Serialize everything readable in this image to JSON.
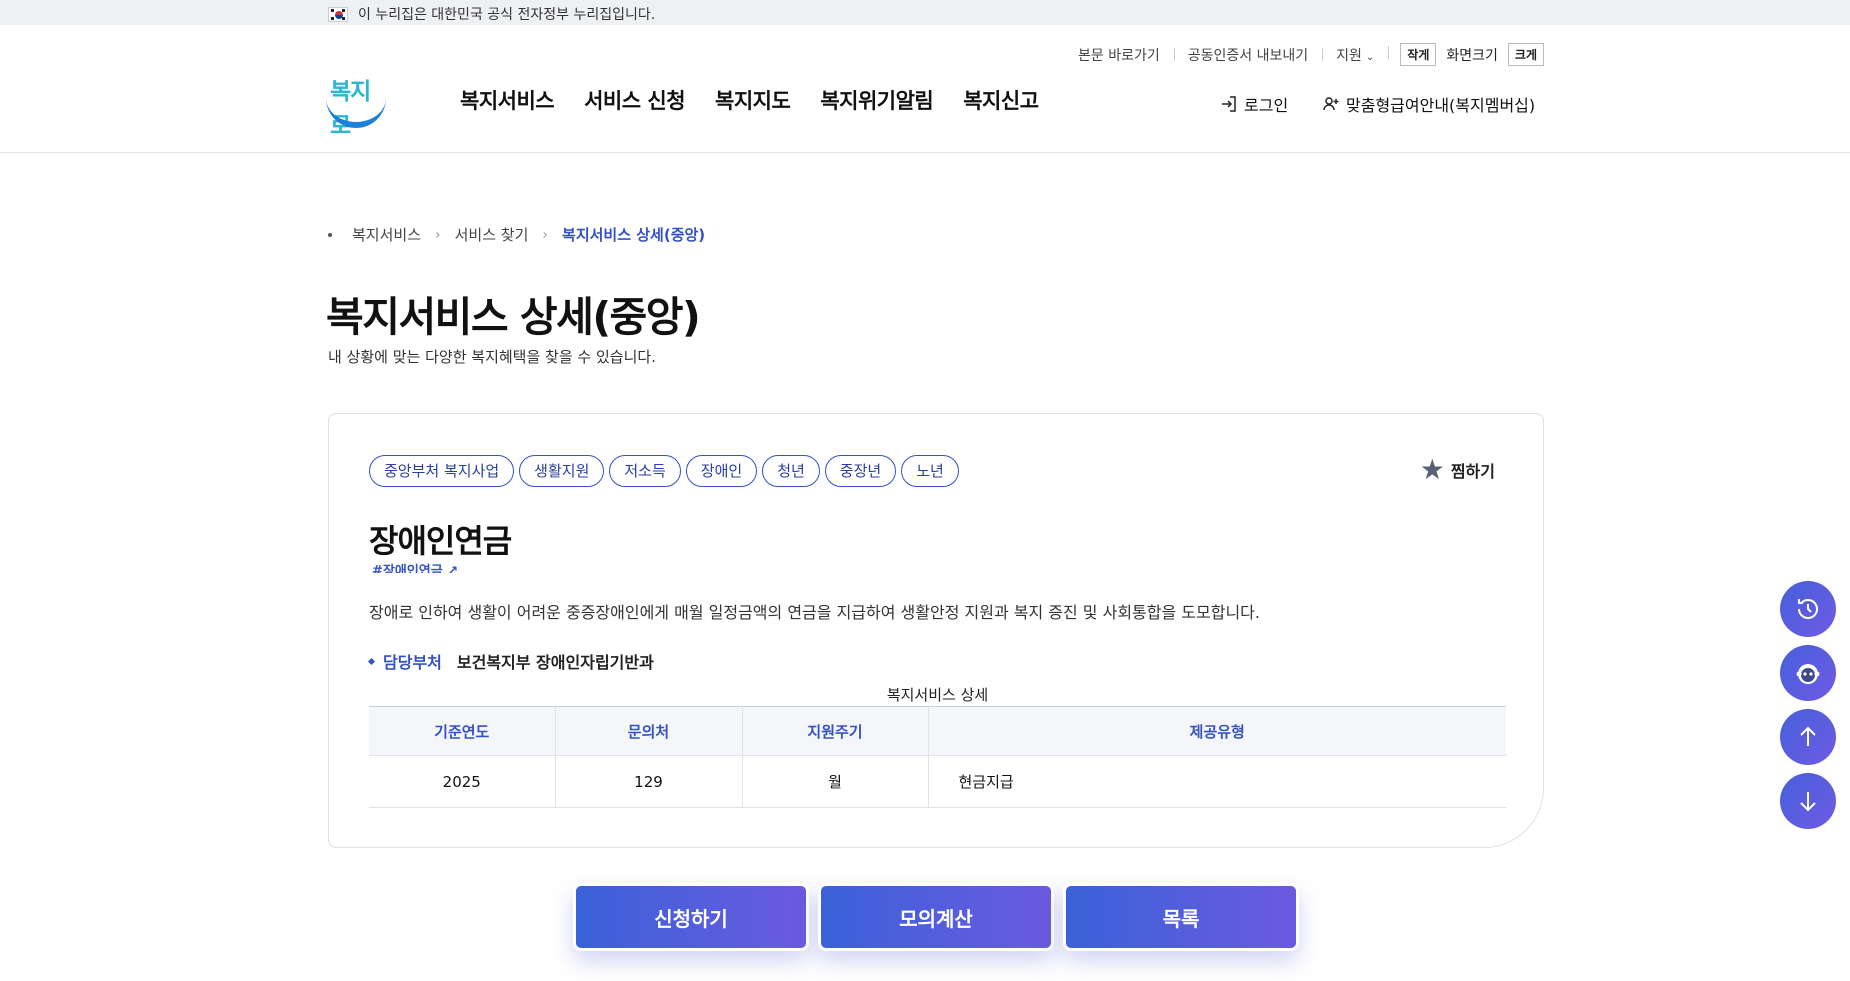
{
  "gov_banner": {
    "text": "이 누리집은 대한민국 공식 전자정부 누리집입니다."
  },
  "util": {
    "skip": "본문 바로가기",
    "cert": "공동인증서 내보내기",
    "support": "지원",
    "small": "작게",
    "screen_size": "화면크기",
    "large": "크게"
  },
  "logo": {
    "text": "복지로"
  },
  "gnb": [
    "복지서비스",
    "서비스 신청",
    "복지지도",
    "복지위기알림",
    "복지신고"
  ],
  "auth": {
    "login": "로그인",
    "member": "맞춤형급여안내(복지멤버십)"
  },
  "breadcrumb": [
    "복지서비스",
    "서비스 찾기",
    "복지서비스 상세(중앙)"
  ],
  "page": {
    "title": "복지서비스 상세(중앙)",
    "desc": "내 상황에 맞는 다양한 복지혜택을 찾을 수 있습니다."
  },
  "service": {
    "tags": [
      "중앙부처 복지사업",
      "생활지원",
      "저소득",
      "장애인",
      "청년",
      "중장년",
      "노년"
    ],
    "favorite": "찜하기",
    "title": "장애인연금",
    "hashtag": "#장애인연금",
    "desc": "장애로 인하여 생활이 어려운 중증장애인에게 매월 일정금액의 연금을 지급하여 생활안정 지원과 복지 증진 및 사회통합을 도모합니다.",
    "dept_label": "담당부처",
    "dept_value": "보건복지부 장애인자립기반과",
    "table_caption": "복지서비스 상세",
    "table_headers": [
      "기준연도",
      "문의처",
      "지원주기",
      "제공유형"
    ],
    "table_row": [
      "2025",
      "129",
      "월",
      "현금지급"
    ]
  },
  "actions": {
    "apply": "신청하기",
    "simulate": "모의계산",
    "list": "목록"
  },
  "quick_icons": [
    "history-icon",
    "chatbot-icon",
    "arrow-up-icon",
    "arrow-down-icon"
  ]
}
